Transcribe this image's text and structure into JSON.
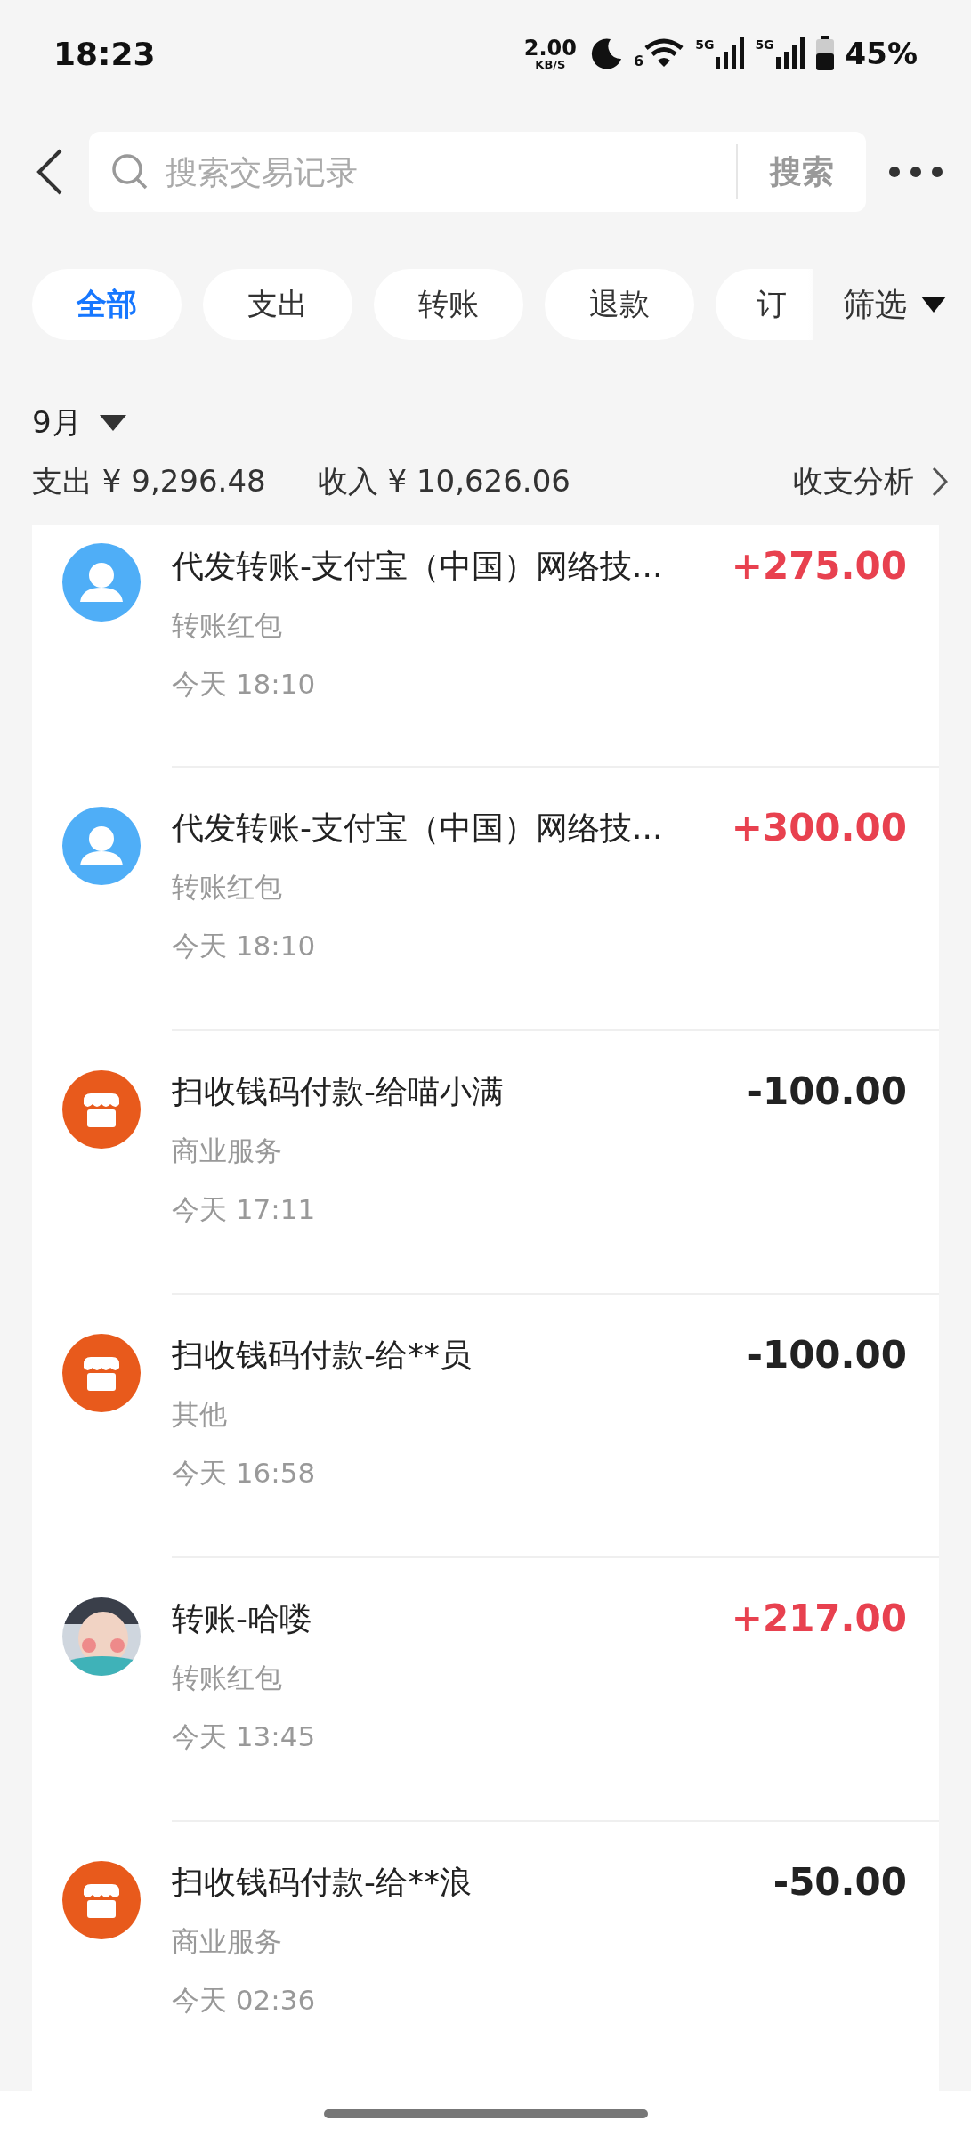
{
  "status_bar": {
    "time": "18:23",
    "speed": "2.00",
    "speed_unit": "KB/S",
    "wifi_badge": "6",
    "signal_1": "5G",
    "signal_2": "5G",
    "battery": "45%"
  },
  "search": {
    "placeholder": "搜索交易记录",
    "button": "搜索"
  },
  "filters": [
    {
      "label": "全部",
      "selected": true
    },
    {
      "label": "支出",
      "selected": false
    },
    {
      "label": "转账",
      "selected": false
    },
    {
      "label": "退款",
      "selected": false
    },
    {
      "label": "订",
      "selected": false
    }
  ],
  "filter_button": "筛选",
  "month": "9月",
  "summary": {
    "expense": "支出 ¥ 9,296.48",
    "income": "收入 ¥ 10,626.06",
    "analysis": "收支分析"
  },
  "transactions": [
    {
      "kind": "person",
      "title": "代发转账-支付宝（中国）网络技...",
      "category": "转账红包",
      "time": "今天 18:10",
      "amount": "+275.00",
      "income": true
    },
    {
      "kind": "person",
      "title": "代发转账-支付宝（中国）网络技...",
      "category": "转账红包",
      "time": "今天 18:10",
      "amount": "+300.00",
      "income": true
    },
    {
      "kind": "shop",
      "title": "扫收钱码付款-给喵小满",
      "category": "商业服务",
      "time": "今天 17:11",
      "amount": "-100.00",
      "income": false
    },
    {
      "kind": "shop",
      "title": "扫收钱码付款-给**员",
      "category": "其他",
      "time": "今天 16:58",
      "amount": "-100.00",
      "income": false
    },
    {
      "kind": "picture",
      "title": "转账-哈喽",
      "category": "转账红包",
      "time": "今天 13:45",
      "amount": "+217.00",
      "income": true
    },
    {
      "kind": "shop",
      "title": "扫收钱码付款-给**浪",
      "category": "商业服务",
      "time": "今天 02:36",
      "amount": "-50.00",
      "income": false
    }
  ]
}
